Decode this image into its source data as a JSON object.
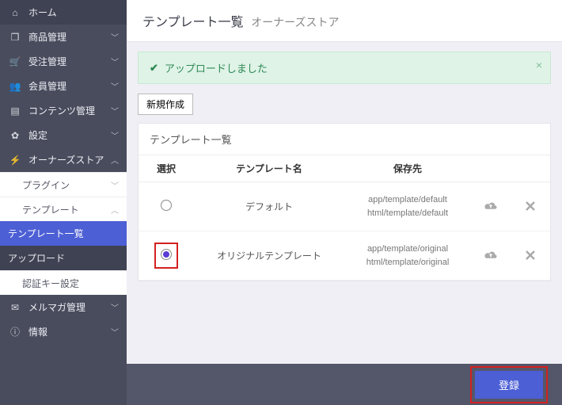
{
  "nav": {
    "home": "ホーム",
    "products": "商品管理",
    "orders": "受注管理",
    "members": "会員管理",
    "contents": "コンテンツ管理",
    "settings": "設定",
    "owners": "オーナーズストア",
    "plugin": "プラグイン",
    "template": "テンプレート",
    "template_list": "テンプレート一覧",
    "upload": "アップロード",
    "authkey": "認証キー設定",
    "mailmag": "メルマガ管理",
    "info": "情報"
  },
  "header": {
    "title": "テンプレート一覧",
    "subtitle": "オーナーズストア"
  },
  "alert": {
    "message": "アップロードしました"
  },
  "buttons": {
    "new": "新規作成",
    "submit": "登録"
  },
  "table": {
    "caption": "テンプレート一覧",
    "cols": {
      "select": "選択",
      "name": "テンプレート名",
      "path": "保存先"
    },
    "rows": [
      {
        "selected": false,
        "highlighted": false,
        "name": "デフォルト",
        "path1": "app/template/default",
        "path2": "html/template/default"
      },
      {
        "selected": true,
        "highlighted": true,
        "name": "オリジナルテンプレート",
        "path1": "app/template/original",
        "path2": "html/template/original"
      }
    ]
  }
}
